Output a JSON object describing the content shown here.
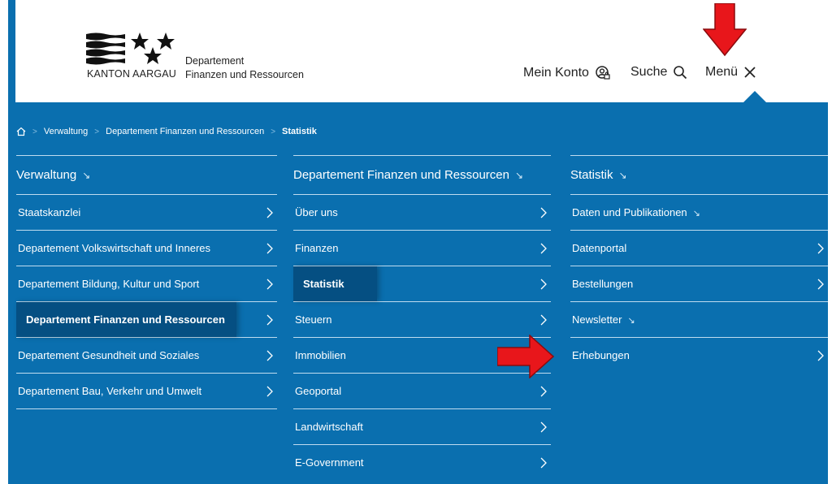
{
  "header": {
    "logo_text": "KANTON AARGAU",
    "dept_line1": "Departement",
    "dept_line2": "Finanzen und Ressourcen",
    "nav": {
      "account_label": "Mein Konto",
      "search_label": "Suche",
      "menu_label": "Menü"
    }
  },
  "breadcrumb": {
    "items": [
      "Verwaltung",
      "Departement Finanzen und Ressourcen",
      "Statistik"
    ]
  },
  "columns": [
    {
      "title": "Verwaltung",
      "items": [
        {
          "label": "Staatskanzlei",
          "chevron": true
        },
        {
          "label": "Departement Volkswirtschaft und Inneres",
          "chevron": true
        },
        {
          "label": "Departement Bildung, Kultur und Sport",
          "chevron": true
        },
        {
          "label": "Departement Finanzen und Ressourcen",
          "chevron": true,
          "active": true
        },
        {
          "label": "Departement Gesundheit und Soziales",
          "chevron": true
        },
        {
          "label": "Departement Bau, Verkehr und Umwelt",
          "chevron": true
        }
      ]
    },
    {
      "title": "Departement Finanzen und Ressourcen",
      "items": [
        {
          "label": "Über uns",
          "chevron": true
        },
        {
          "label": "Finanzen",
          "chevron": true
        },
        {
          "label": "Statistik",
          "chevron": true,
          "active": true
        },
        {
          "label": "Steuern",
          "chevron": true
        },
        {
          "label": "Immobilien",
          "chevron": true
        },
        {
          "label": "Geoportal",
          "chevron": true
        },
        {
          "label": "Landwirtschaft",
          "chevron": true
        },
        {
          "label": "E-Government",
          "chevron": true
        }
      ]
    },
    {
      "title": "Statistik",
      "items": [
        {
          "label": "Daten und Publikationen",
          "chevron": false
        },
        {
          "label": "Datenportal",
          "chevron": true
        },
        {
          "label": "Bestellungen",
          "chevron": true
        },
        {
          "label": "Newsletter",
          "chevron": false
        },
        {
          "label": "Erhebungen",
          "chevron": true
        }
      ]
    }
  ],
  "colors": {
    "brand_blue": "#0a6faf",
    "active_blue": "#054f82",
    "annotation_red": "#e8161b"
  }
}
